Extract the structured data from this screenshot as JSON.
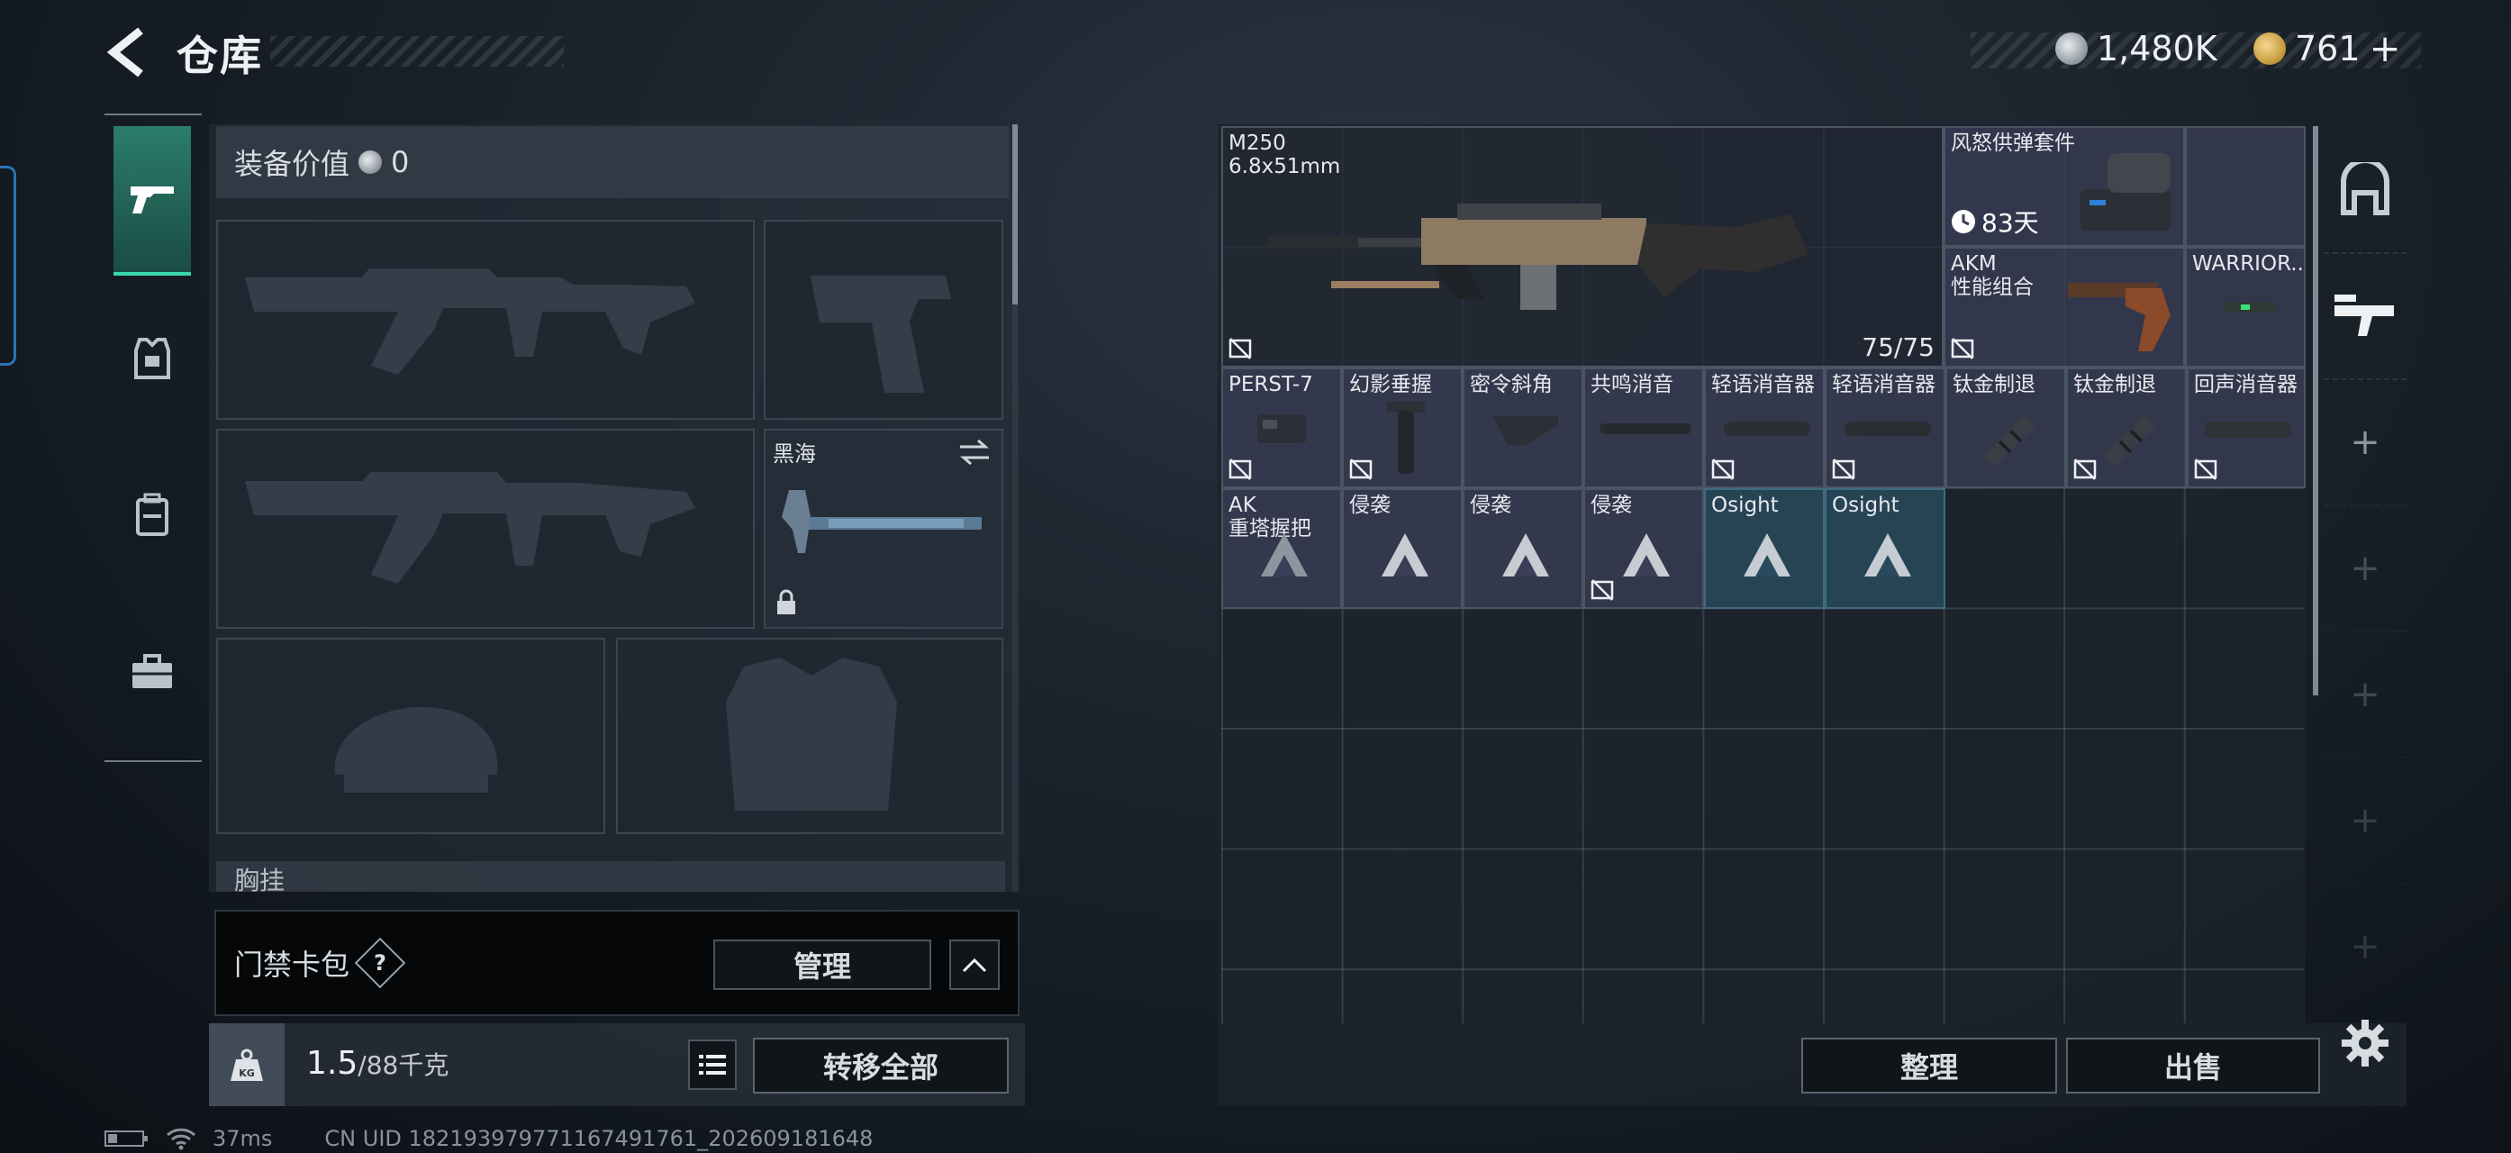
{
  "header": {
    "title": "仓库",
    "currency": {
      "silver": "1,480K",
      "gold": "761"
    },
    "add_label": "+"
  },
  "tabs": [
    {
      "icon": "pistol-icon",
      "active": true
    },
    {
      "icon": "vest-icon",
      "active": false
    },
    {
      "icon": "backpack-icon",
      "active": false
    },
    {
      "icon": "toolbox-icon",
      "active": false
    }
  ],
  "equipment": {
    "value_label": "装备价值",
    "value": "0",
    "melee_name": "黑海",
    "chest_label": "胸挂",
    "access_label": "门禁卡包",
    "help": "?",
    "manage": "管理",
    "weight": "1.5",
    "capacity": "/88千克",
    "weight_unit": "KG",
    "transfer": "转移全部"
  },
  "storage": {
    "items": [
      {
        "name": "M250\n6.8x51mm",
        "ammo": "75/75"
      },
      {
        "name": "风怒供弹套件",
        "timer": "83天"
      },
      {
        "name": "AKM\n性能组合"
      },
      {
        "name": "WARRIOR..."
      },
      {
        "name": "PERST-7"
      },
      {
        "name": "幻影垂握"
      },
      {
        "name": "密令斜角"
      },
      {
        "name": "共鸣消音"
      },
      {
        "name": "轻语消音器"
      },
      {
        "name": "轻语消音器"
      },
      {
        "name": "钛金制退"
      },
      {
        "name": "钛金制退"
      },
      {
        "name": "回声消音器"
      },
      {
        "name": "AK\n重塔握把"
      },
      {
        "name": "侵袭"
      },
      {
        "name": "侵袭"
      },
      {
        "name": "侵袭"
      },
      {
        "name": "Osight"
      },
      {
        "name": "Osight"
      }
    ],
    "sort": "整理",
    "sell": "出售"
  },
  "sidebar_right": {
    "plus": "+"
  },
  "status": {
    "ping": "37ms",
    "uid": "CN UID 182193979771167491761_202609181648"
  },
  "colors": {
    "accent": "#37d9ab",
    "item_bg": "#3a3e56",
    "teal_item": "#284a5c"
  }
}
